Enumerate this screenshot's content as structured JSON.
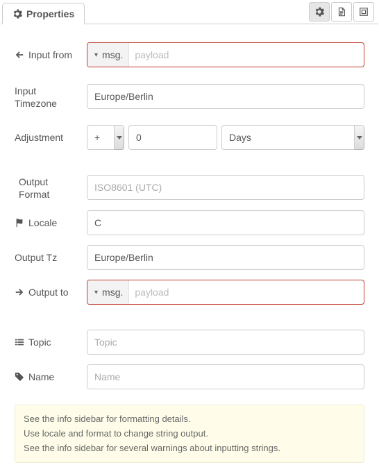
{
  "header": {
    "tab_label": "Properties"
  },
  "labels": {
    "input_from": "Input from",
    "input_tz": "Input Timezone",
    "adjustment": "Adjustment",
    "output_format": "Output Format",
    "locale": "Locale",
    "output_tz": "Output Tz",
    "output_to": "Output to",
    "topic": "Topic",
    "name": "Name"
  },
  "fields": {
    "input_from": {
      "type_label": "msg.",
      "placeholder": "payload",
      "value": ""
    },
    "input_tz": {
      "value": "Europe/Berlin"
    },
    "adjustment": {
      "sign": "+",
      "amount": "0",
      "unit": "Days"
    },
    "output_format": {
      "value": "",
      "placeholder": "ISO8601 (UTC)"
    },
    "locale": {
      "value": "C"
    },
    "output_tz": {
      "value": "Europe/Berlin"
    },
    "output_to": {
      "type_label": "msg.",
      "placeholder": "payload",
      "value": ""
    },
    "topic": {
      "value": "",
      "placeholder": "Topic"
    },
    "name": {
      "value": "",
      "placeholder": "Name"
    }
  },
  "note": {
    "line1": "See the info sidebar for formatting details.",
    "line2": "Use locale and format to change string output.",
    "line3": "See the info sidebar for several warnings about inputting strings."
  }
}
